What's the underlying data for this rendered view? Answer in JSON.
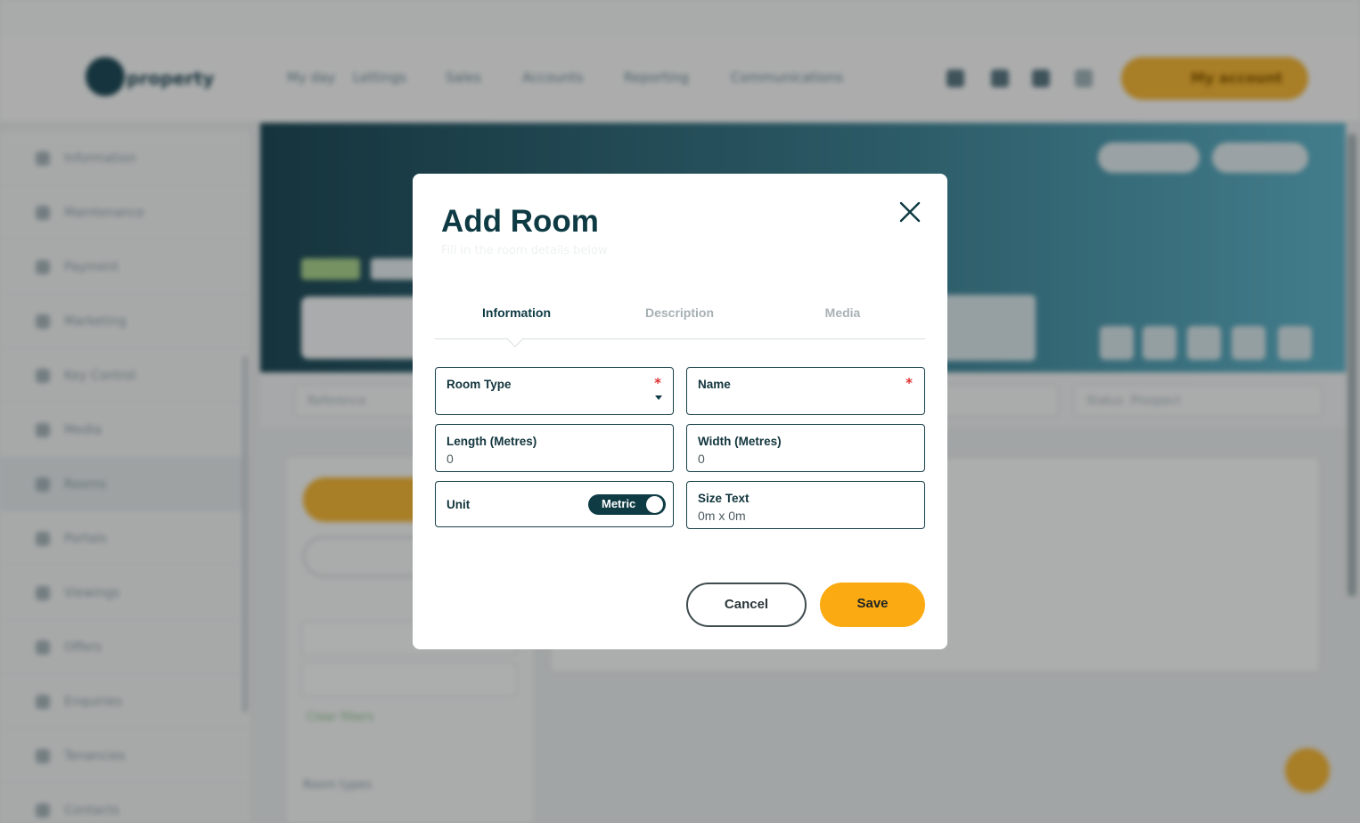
{
  "modal": {
    "title": "Add Room",
    "subtitle": "Fill in the room details below",
    "tabs": [
      {
        "label": "Information",
        "active": true
      },
      {
        "label": "Description",
        "active": false
      },
      {
        "label": "Media",
        "active": false
      }
    ],
    "fields": {
      "room_type": {
        "label": "Room Type",
        "required": true,
        "value": ""
      },
      "name": {
        "label": "Name",
        "required": true,
        "value": ""
      },
      "length": {
        "label": "Length (Metres)",
        "value": "0"
      },
      "width": {
        "label": "Width (Metres)",
        "value": "0"
      },
      "unit": {
        "label": "Unit",
        "toggle_label": "Metric",
        "on": true
      },
      "size_text": {
        "label": "Size Text",
        "value": "0m x 0m"
      }
    },
    "required_marker": "*",
    "buttons": {
      "cancel": "Cancel",
      "save": "Save"
    },
    "close_icon": "close-icon"
  },
  "background": {
    "nav": [
      "My day",
      "Lettings",
      "Sales",
      "Accounts",
      "Reporting",
      "Communications"
    ],
    "account_button": "My account",
    "sidebar": [
      "Information",
      "Maintenance",
      "Payment",
      "Marketing",
      "Key Control",
      "Media",
      "Rooms",
      "Portals",
      "Viewings",
      "Offers",
      "Enquiries",
      "Tenancies",
      "Contacts"
    ],
    "filter_reference": "Reference",
    "filter_status": "Status",
    "filter_status_value": "Prospect",
    "clear_filters": "Clear filters",
    "room_types": "Room types"
  },
  "colors": {
    "accent": "#fbaa12",
    "primary_dark": "#0e3a43",
    "required": "#e03131"
  }
}
